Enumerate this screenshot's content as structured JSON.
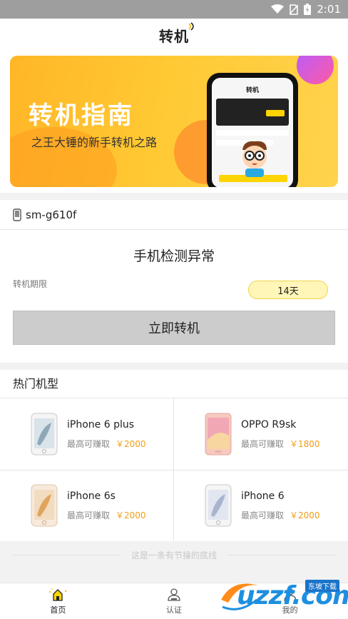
{
  "status": {
    "time": "2:01"
  },
  "header": {
    "logo_text": "转机"
  },
  "banner": {
    "title": "转机指南",
    "subtitle": "之王大锤的新手转机之路",
    "phone_logo": "转机",
    "colors": {
      "start": "#ffb627",
      "end": "#ffd34d"
    }
  },
  "device": {
    "model": "sm-g610f",
    "status_title": "手机检测异常",
    "period_label": "转机期限",
    "period_value": "14天",
    "switch_button": "立即转机"
  },
  "hot": {
    "title": "热门机型",
    "price_prefix": "最高可赚取",
    "items": [
      {
        "name": "iPhone 6 plus",
        "price": "￥2000",
        "icon": "iphone-silver"
      },
      {
        "name": "OPPO R9sk",
        "price": "￥1800",
        "icon": "oppo-pink"
      },
      {
        "name": "iPhone 6s",
        "price": "￥2000",
        "icon": "iphone-gold"
      },
      {
        "name": "iPhone 6",
        "price": "￥2000",
        "icon": "iphone-silver"
      }
    ]
  },
  "footer_line": "这是一条有节操的底线",
  "tabs": [
    {
      "label": "首页",
      "icon": "home-icon",
      "active": true
    },
    {
      "label": "认证",
      "icon": "certify-icon",
      "active": false
    },
    {
      "label": "我的",
      "icon": "profile-icon",
      "active": false
    }
  ],
  "watermark": {
    "brand": "uzzf.com",
    "tag": "东坡下载"
  },
  "accent_color": "#f39c12"
}
